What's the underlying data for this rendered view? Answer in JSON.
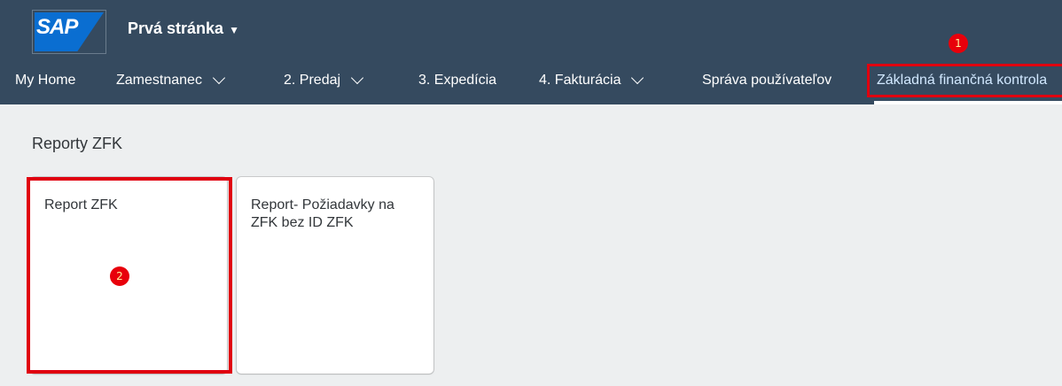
{
  "header": {
    "logo": "SAP",
    "page_title": "Prvá stránka",
    "page_caret": "▼"
  },
  "nav": {
    "items": [
      {
        "label": "My Home",
        "has_dropdown": false
      },
      {
        "label": "Zamestnanec",
        "has_dropdown": true
      },
      {
        "label": "2. Predaj",
        "has_dropdown": true
      },
      {
        "label": "3. Expedícia",
        "has_dropdown": false
      },
      {
        "label": "4. Fakturácia",
        "has_dropdown": true
      },
      {
        "label": "Správa používateľov",
        "has_dropdown": false
      },
      {
        "label": "Základná finančná kontrola",
        "has_dropdown": false,
        "active": true
      }
    ]
  },
  "group": {
    "title": "Reporty ZFK",
    "tiles": [
      {
        "title": "Report ZFK"
      },
      {
        "title": "Report- Požiadavky na ZFK bez ID ZFK"
      }
    ]
  },
  "annotations": {
    "badge_1": "1",
    "badge_2": "2",
    "highlight_color": "#e0000f"
  },
  "colors": {
    "shell": "#354a5f",
    "brand": "#0a6ed1",
    "content_bg": "#edeff0"
  }
}
